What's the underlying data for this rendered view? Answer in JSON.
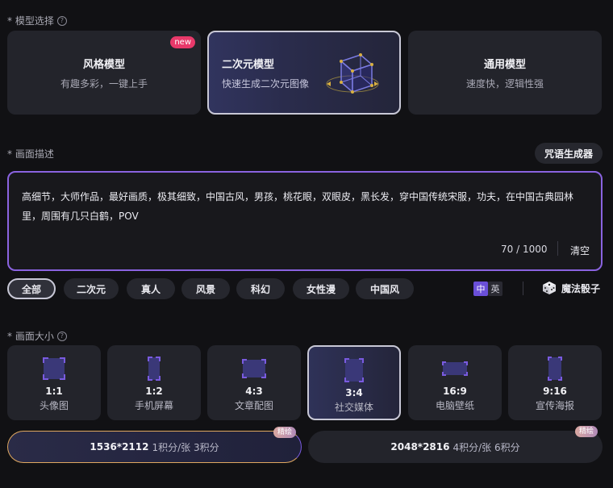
{
  "model_section": {
    "label": "* 模型选择",
    "cards": [
      {
        "title": "风格模型",
        "subtitle": "有趣多彩，一键上手",
        "badge": "new"
      },
      {
        "title": "二次元模型",
        "subtitle": "快速生成二次元图像"
      },
      {
        "title": "通用模型",
        "subtitle": "速度快，逻辑性强"
      }
    ]
  },
  "prompt_section": {
    "label": "* 画面描述",
    "generator_label": "咒语生成器",
    "text": "高细节，大师作品，最好画质，极其细致，中国古风，男孩，桃花眼，双眼皮，黑长发，穿中国传统宋服，功夫，在中国古典园林里，周围有几只白鹤，POV",
    "counter": "70 / 1000",
    "clear_label": "清空"
  },
  "tags": [
    "全部",
    "二次元",
    "真人",
    "风景",
    "科幻",
    "女性漫",
    "中国风"
  ],
  "lang": {
    "zh": "中",
    "en": "英"
  },
  "dice_label": "魔法骰子",
  "size_section": {
    "label": "* 画面大小",
    "cards": [
      {
        "ratio": "1:1",
        "name": "头像图"
      },
      {
        "ratio": "1:2",
        "name": "手机屏幕"
      },
      {
        "ratio": "4:3",
        "name": "文章配图"
      },
      {
        "ratio": "3:4",
        "name": "社交媒体"
      },
      {
        "ratio": "16:9",
        "name": "电脑壁纸"
      },
      {
        "ratio": "9:16",
        "name": "宣传海报"
      }
    ]
  },
  "resolutions": [
    {
      "main": "1536*2112",
      "sub": "1积分/张 3积分",
      "badge": "精绘"
    },
    {
      "main": "2048*2816",
      "sub": "4积分/张 6积分",
      "badge": "精绘"
    }
  ],
  "colors": {
    "accent": "#8a63e0",
    "badge_new": "#e8396a",
    "shape": "#5a4fd8"
  }
}
